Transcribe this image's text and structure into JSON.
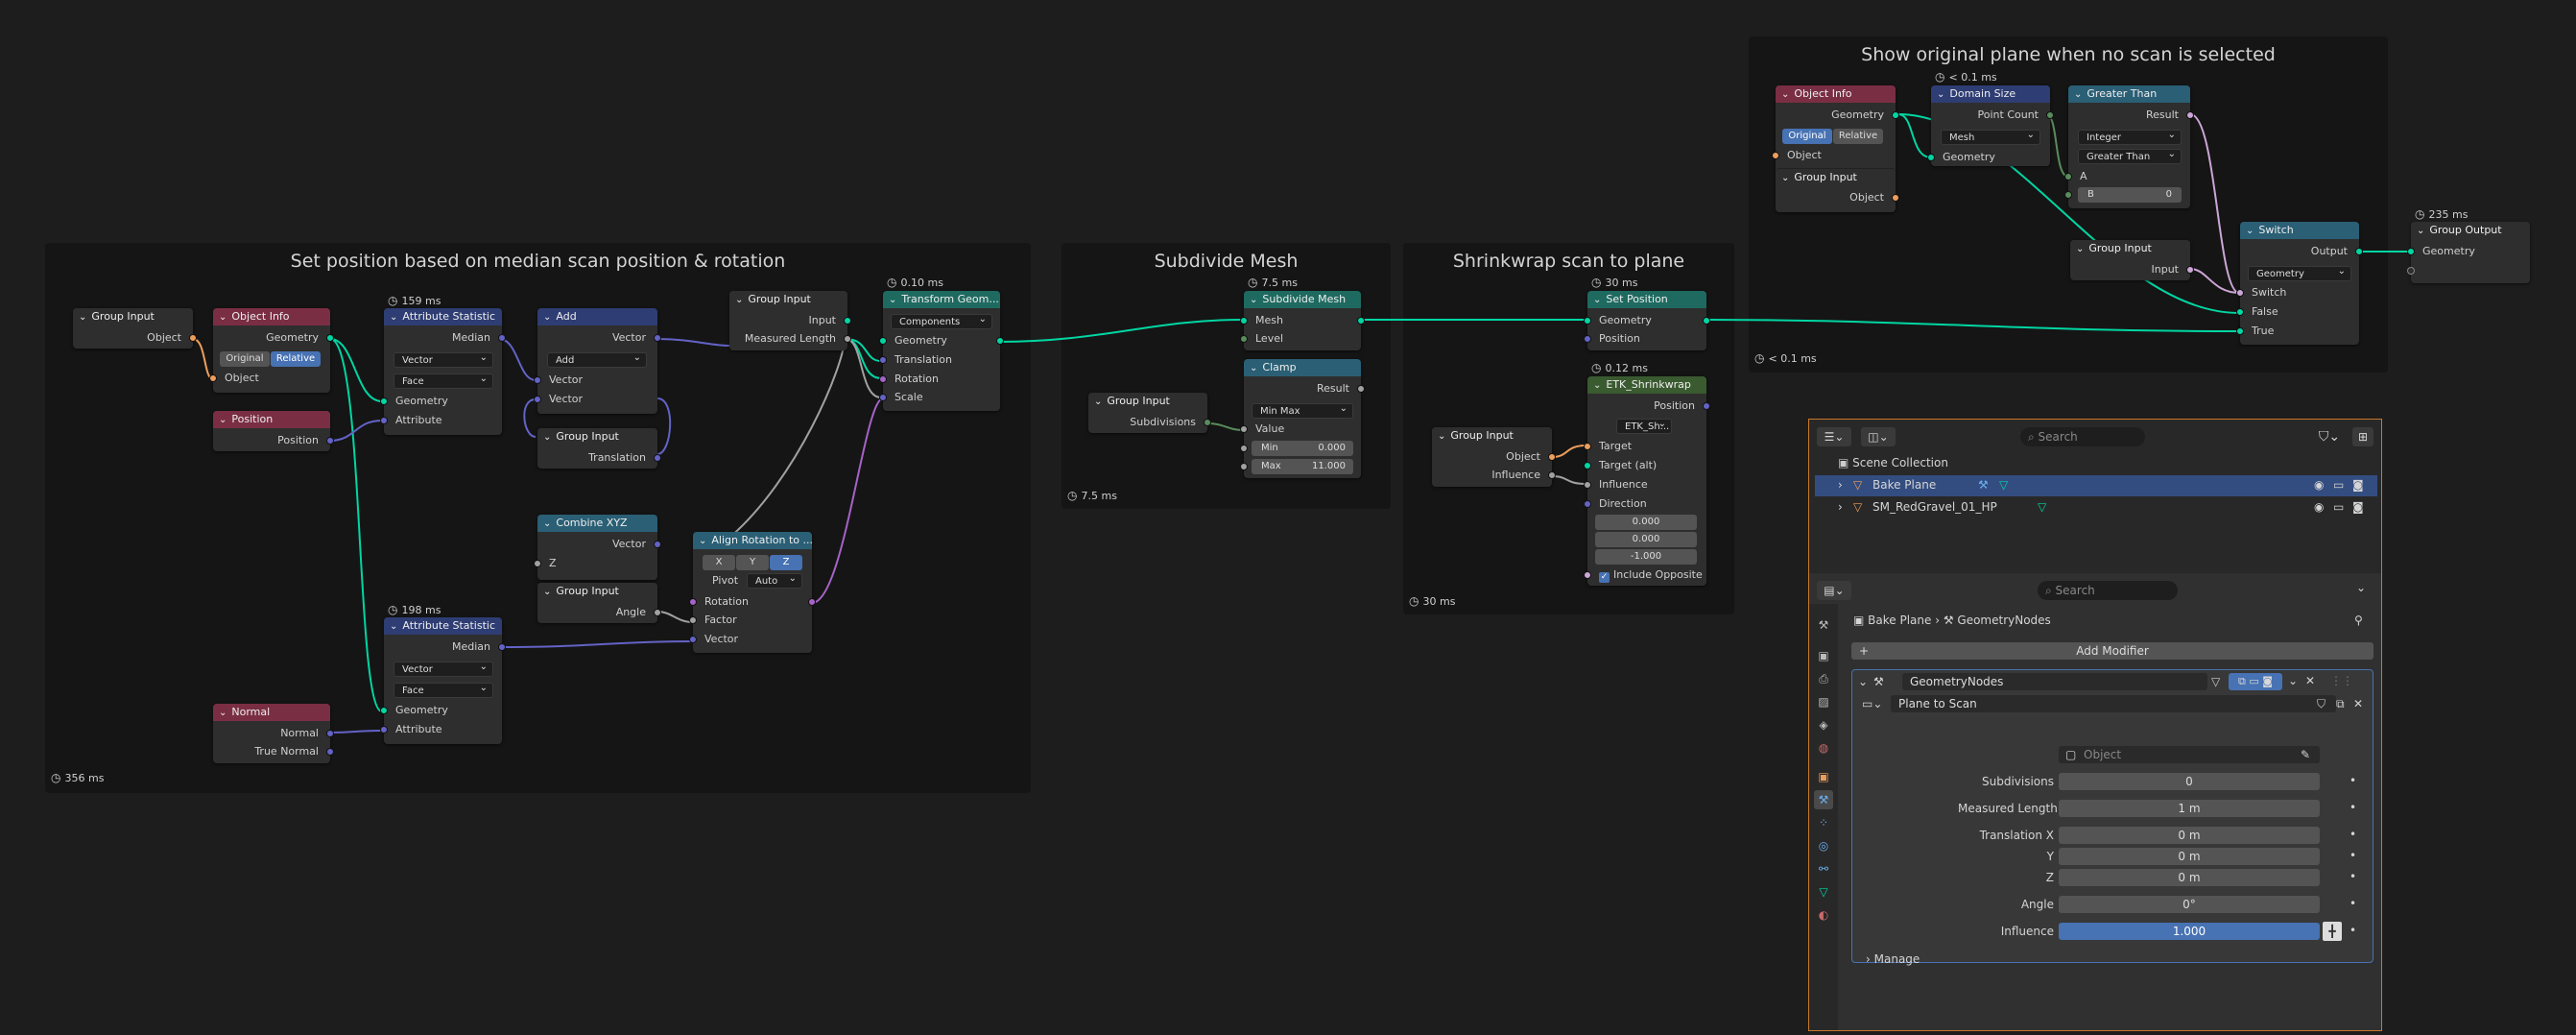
{
  "frames": {
    "median": "Set position based on median scan position & rotation",
    "subdivide": "Subdivide Mesh",
    "shrinkwrap": "Shrinkwrap scan to plane",
    "original": "Show original plane when no scan is selected"
  },
  "timings": {
    "median": "356 ms",
    "subdivide": "7.5 ms",
    "shrinkwrap": "30 ms",
    "original": "< 0.1 ms",
    "stat1": "159 ms",
    "stat2": "198 ms",
    "transform": "0.10 ms",
    "subdivnode": "7.5 ms",
    "setpos": "30 ms",
    "etk": "0.12 ms",
    "domain": "< 0.1 ms",
    "output": "235 ms"
  },
  "nodes": {
    "group_input": "Group Input",
    "object": "Object",
    "object_info": "Object Info",
    "geometry": "Geometry",
    "original": "Original",
    "relative": "Relative",
    "position": "Position",
    "attribute_statistic": "Attribute Statistic",
    "median": "Median",
    "vector": "Vector",
    "face": "Face",
    "attribute": "Attribute",
    "add": "Add",
    "translation": "Translation",
    "input": "Input",
    "measured_length": "Measured Length",
    "transform_geometry": "Transform Geom...",
    "components": "Components",
    "rotation": "Rotation",
    "scale": "Scale",
    "combine_xyz": "Combine XYZ",
    "z": "Z",
    "angle": "Angle",
    "align_rotation": "Align Rotation to ...",
    "x": "X",
    "y": "Y",
    "pivot": "Pivot",
    "auto": "Auto",
    "factor": "Factor",
    "normal": "Normal",
    "true_normal": "True Normal",
    "subdivide_mesh": "Subdivide Mesh",
    "mesh": "Mesh",
    "level": "Level",
    "clamp": "Clamp",
    "result": "Result",
    "min_max": "Min Max",
    "value": "Value",
    "min": "Min",
    "min_val": "0.000",
    "max": "Max",
    "max_val": "11.000",
    "subdivisions": "Subdivisions",
    "set_position": "Set Position",
    "etk_shrinkwrap": "ETK_Shrinkwrap",
    "etk_sh": "ETK_Sh...",
    "target": "Target",
    "target_alt": "Target (alt)",
    "influence": "Influence",
    "direction": "Direction",
    "dir_x": "0.000",
    "dir_y": "0.000",
    "dir_z": "-1.000",
    "include_opposite": "Include Opposite",
    "domain_size": "Domain Size",
    "point_count": "Point Count",
    "greater_than": "Greater Than",
    "integer": "Integer",
    "a": "A",
    "b": "B",
    "b_val": "0",
    "switch": "Switch",
    "output": "Output",
    "false": "False",
    "true": "True",
    "group_output": "Group Output"
  },
  "outliner": {
    "search": "Search",
    "scene_collection": "Scene Collection",
    "items": [
      "Bake Plane",
      "SM_RedGravel_01_HP"
    ]
  },
  "properties": {
    "search": "Search",
    "breadcrumb": [
      "Bake Plane",
      "GeometryNodes"
    ],
    "add_modifier": "Add Modifier",
    "modifier_name": "GeometryNodes",
    "node_group": "Plane to Scan",
    "fields": [
      {
        "label": "Object",
        "value": "Object"
      },
      {
        "label": "Subdivisions",
        "value": "0"
      },
      {
        "label": "Measured Length",
        "value": "1 m"
      },
      {
        "label": "Translation X",
        "value": "0 m"
      },
      {
        "label": "Y",
        "value": "0 m"
      },
      {
        "label": "Z",
        "value": "0 m"
      },
      {
        "label": "Angle",
        "value": "0°"
      },
      {
        "label": "Influence",
        "value": "1.000"
      }
    ],
    "manage": "Manage"
  },
  "colors": {
    "geometry": "#00d6a3",
    "object": "#ed9e5c",
    "vector": "#6363c7",
    "rotation": "#a663c7",
    "accent": "#4772b3",
    "panel_border": "#c9782a"
  }
}
